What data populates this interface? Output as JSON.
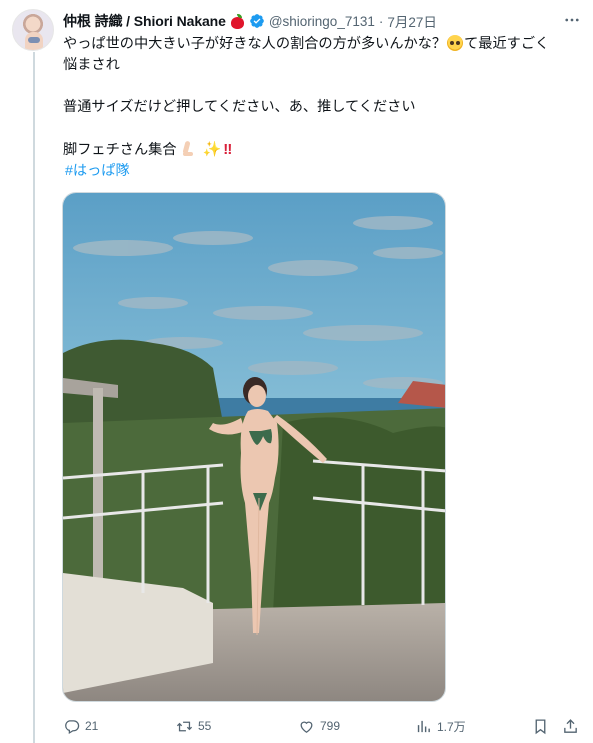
{
  "author": {
    "display_name": "仲根 詩織 / Shiori Nakane",
    "handle": "@shioringo_7131",
    "separator": "·",
    "date": "7月27日",
    "icons": [
      "red-apple-icon",
      "verified-badge-icon"
    ]
  },
  "tweet": {
    "line1": "やっぱ世の中大きい子が好きな人の割合の方が多いんかな？",
    "line1_after_emoji": "て最近すごく",
    "line2": "悩まされ",
    "line3": "普通サイズだけど押してください、あ、推してください",
    "line4": "脚フェチさん集合",
    "line4_emoji_sparkles": "✨",
    "line4_emoji_bang": "‼",
    "hashtag": "#はっぱ隊"
  },
  "actions": {
    "replies": "21",
    "reposts": "55",
    "likes": "799",
    "views": "1.7万"
  },
  "colors": {
    "accent": "#1d9bf0",
    "muted_text": "#536471",
    "text": "#0f1419",
    "verified": "#1d9bf0",
    "apple": "#e0152b"
  }
}
